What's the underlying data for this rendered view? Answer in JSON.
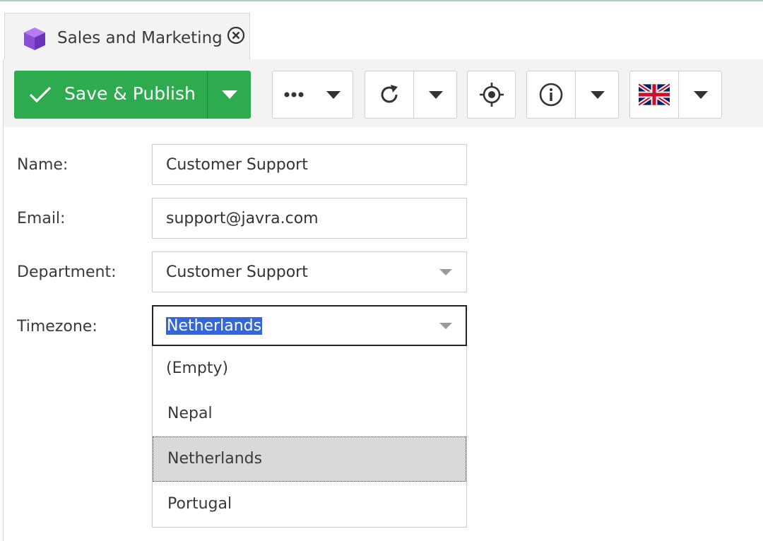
{
  "tab": {
    "title": "Sales and Marketing",
    "icon": "cube-icon",
    "close_icon": "close-circle-icon",
    "icon_color": "#8a4fd6"
  },
  "toolbar": {
    "save_label": "Save & Publish",
    "save_color": "#2eaa4f",
    "buttons": [
      "more-options-icon",
      "reload-icon",
      "locate-icon",
      "info-icon",
      "uk-flag-icon"
    ]
  },
  "form": {
    "name": {
      "label": "Name:",
      "value": "Customer Support"
    },
    "email": {
      "label": "Email:",
      "value": "support@javra.com"
    },
    "department": {
      "label": "Department:",
      "value": "Customer Support"
    },
    "timezone": {
      "label": "Timezone:",
      "value": "Netherlands"
    }
  },
  "timezone_dropdown": {
    "options": [
      "(Empty)",
      "Nepal",
      "Netherlands",
      "Portugal"
    ],
    "highlighted": "Netherlands"
  }
}
